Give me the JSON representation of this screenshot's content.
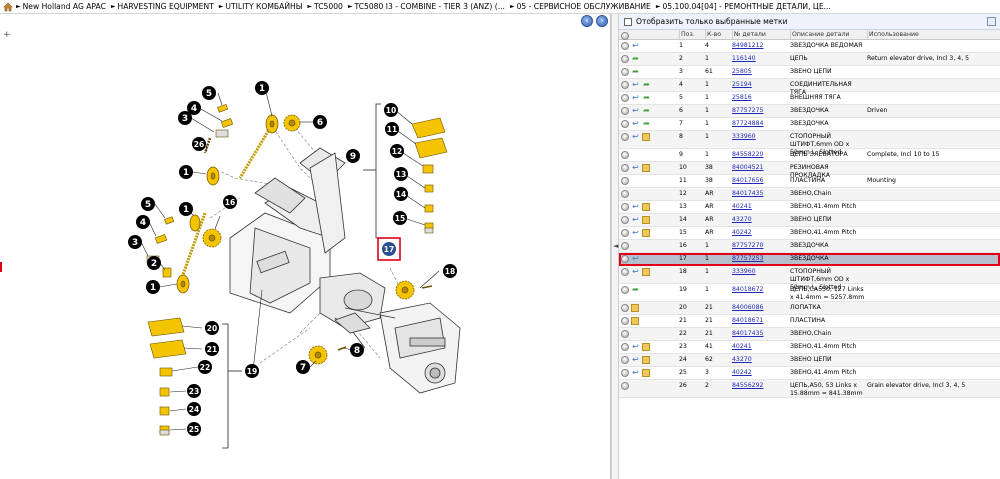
{
  "breadcrumb": [
    "New Holland AG APAC",
    "HARVESTING EQUIPMENT",
    "UTILITY КОМБАЙНЫ",
    "TC5000",
    "TC5080 I3 - COMBINE - TIER 3 (ANZ) (...",
    "05 - СЕРВИСНОЕ ОБСЛУЖИВАНИЕ",
    "05.100.04[04] - РЕМОНТНЫЕ ДЕТАЛИ, ЦЕ..."
  ],
  "nav": {
    "back_icon": "arrow-left-icon",
    "forward_icon": "arrow-right-icon",
    "zoom": "+"
  },
  "filter": {
    "label": "Отобразить только выбранные метки"
  },
  "table": {
    "headers": {
      "pos": "Поз.",
      "qty": "К-во",
      "part": "№ детали",
      "desc": "Описание детали",
      "use": "Использование"
    },
    "rows": [
      {
        "pos": "1",
        "qty": "4",
        "part": "84981212",
        "desc": "ЗВЕЗДОЧКА ВЕДОМАЯ",
        "use": "",
        "icons": [
          "gray",
          "blue"
        ]
      },
      {
        "pos": "2",
        "qty": "1",
        "part": "116140",
        "desc": "ЦЕПЬ",
        "use": "Return elevator drive, Incl 3, 4, 5",
        "icons": [
          "gray",
          "green"
        ]
      },
      {
        "pos": "3",
        "qty": "61",
        "part": "25805",
        "desc": "ЗВЕНО ЦЕПИ",
        "use": "",
        "icons": [
          "gray",
          "green"
        ]
      },
      {
        "pos": "4",
        "qty": "1",
        "part": "25194",
        "desc": "СОЕДИНИТЕЛЬНАЯ ТЯГА",
        "use": "",
        "icons": [
          "gray",
          "blue",
          "green"
        ]
      },
      {
        "pos": "5",
        "qty": "1",
        "part": "25816",
        "desc": "ВНЕШНЯЯ ТЯГА",
        "use": "",
        "icons": [
          "gray",
          "blue",
          "green"
        ]
      },
      {
        "pos": "6",
        "qty": "1",
        "part": "87757275",
        "desc": "ЗВЕЗДОЧКА",
        "use": "Driven",
        "icons": [
          "gray",
          "blue",
          "green"
        ]
      },
      {
        "pos": "7",
        "qty": "1",
        "part": "87724884",
        "desc": "ЗВЕЗДОЧКА",
        "use": "",
        "icons": [
          "gray",
          "blue",
          "green"
        ]
      },
      {
        "pos": "8",
        "qty": "1",
        "part": "333960",
        "desc": "СТОПОРНЫЙ ШТИФТ,6mm OD x 50mm L, Slotted",
        "use": "",
        "icons": [
          "gray",
          "blue",
          "box"
        ]
      },
      {
        "pos": "9",
        "qty": "1",
        "part": "84558220",
        "desc": "ЦЕПЬ ЭЛЕВАТОРА",
        "use": "Complete, Incl 10 to 15",
        "icons": [
          "gray"
        ]
      },
      {
        "pos": "10",
        "qty": "38",
        "part": "84004521",
        "desc": "РЕЗИНОВАЯ ПРОКЛАДКА",
        "use": "",
        "icons": [
          "gray",
          "blue",
          "box"
        ]
      },
      {
        "pos": "11",
        "qty": "38",
        "part": "84017656",
        "desc": "ПЛАСТИНА",
        "use": "Mounting",
        "icons": [
          "gray"
        ]
      },
      {
        "pos": "12",
        "qty": "AR",
        "part": "84017435",
        "desc": "ЗВЕНО,Chain",
        "use": "",
        "icons": [
          "gray"
        ]
      },
      {
        "pos": "13",
        "qty": "AR",
        "part": "40241",
        "desc": "ЗВЕНО,41.4mm Pitch",
        "use": "",
        "icons": [
          "gray",
          "blue",
          "box"
        ]
      },
      {
        "pos": "14",
        "qty": "AR",
        "part": "43270",
        "desc": "ЗВЕНО ЦЕПИ",
        "use": "",
        "icons": [
          "gray",
          "blue",
          "box"
        ]
      },
      {
        "pos": "15",
        "qty": "AR",
        "part": "40242",
        "desc": "ЗВЕНО,41.4mm Pitch",
        "use": "",
        "icons": [
          "gray",
          "blue",
          "box"
        ]
      },
      {
        "pos": "16",
        "qty": "1",
        "part": "87757270",
        "desc": "ЗВЕЗДОЧКА",
        "use": "",
        "icons": [
          "gray"
        ]
      },
      {
        "pos": "17",
        "qty": "1",
        "part": "87757253",
        "desc": "ЗВЕЗДОЧКА",
        "use": "",
        "icons": [
          "gray",
          "blue"
        ],
        "selected": true
      },
      {
        "pos": "18",
        "qty": "1",
        "part": "333960",
        "desc": "СТОПОРНЫЙ ШТИФТ,6mm OD x 50mm L, Slotted",
        "use": "",
        "icons": [
          "gray",
          "blue",
          "box"
        ]
      },
      {
        "pos": "19",
        "qty": "1",
        "part": "84018672",
        "desc": "ЦЕПЬ,CA550, 127 Links x 41.4mm = 5257.8mm",
        "use": "",
        "icons": [
          "gray",
          "green"
        ]
      },
      {
        "pos": "20",
        "qty": "21",
        "part": "84006086",
        "desc": "ЛОПАТКА",
        "use": "",
        "icons": [
          "gray",
          "box"
        ]
      },
      {
        "pos": "21",
        "qty": "21",
        "part": "84018671",
        "desc": "ПЛАСТИНА",
        "use": "",
        "icons": [
          "gray",
          "box"
        ]
      },
      {
        "pos": "22",
        "qty": "21",
        "part": "84017435",
        "desc": "ЗВЕНО,Chain",
        "use": "",
        "icons": [
          "gray"
        ]
      },
      {
        "pos": "23",
        "qty": "41",
        "part": "40241",
        "desc": "ЗВЕНО,41.4mm Pitch",
        "use": "",
        "icons": [
          "gray",
          "blue",
          "box"
        ]
      },
      {
        "pos": "24",
        "qty": "62",
        "part": "43270",
        "desc": "ЗВЕНО ЦЕПИ",
        "use": "",
        "icons": [
          "gray",
          "blue",
          "box"
        ]
      },
      {
        "pos": "25",
        "qty": "3",
        "part": "40242",
        "desc": "ЗВЕНО,41.4mm Pitch",
        "use": "",
        "icons": [
          "gray",
          "blue",
          "box"
        ]
      },
      {
        "pos": "26",
        "qty": "2",
        "part": "84556292",
        "desc": "ЦЕПЬ,A50, 53 Links x 15.88mm = 841.38mm",
        "use": "Grain elevator drive, Incl 3, 4, 5",
        "icons": [
          "gray"
        ]
      }
    ]
  },
  "diagram": {
    "callouts": [
      "1",
      "2",
      "3",
      "4",
      "5",
      "6",
      "7",
      "8",
      "9",
      "10",
      "11",
      "12",
      "13",
      "14",
      "15",
      "16",
      "17",
      "18",
      "19",
      "20",
      "21",
      "22",
      "23",
      "24",
      "25",
      "26"
    ],
    "selected": "17",
    "colors": {
      "part_yellow": "#f5c400",
      "label_fill": "#000000",
      "selected_fill": "#2a4f8f",
      "highlight": "#e1001a"
    }
  }
}
